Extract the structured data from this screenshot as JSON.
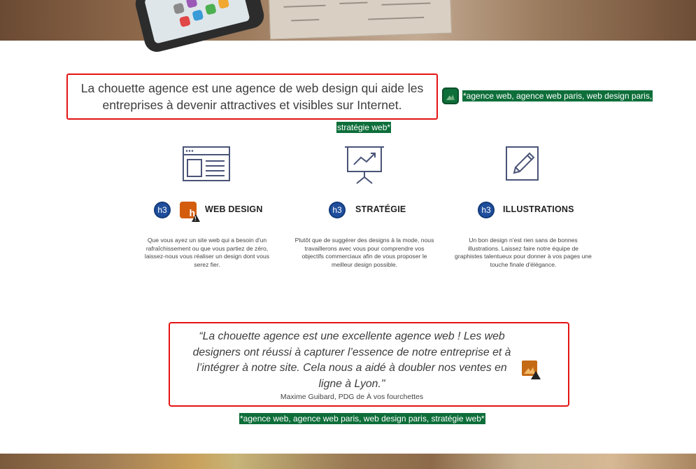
{
  "intro": {
    "text": "La chouette agence est une agence de web design qui aide les entreprises à devenir attractives et visibles sur Internet.",
    "alt_line1": "*agence web, agence web paris, web design paris,",
    "alt_line2": "stratégie web*"
  },
  "services": [
    {
      "icon": "browser-window-icon",
      "heading_tag": "h3",
      "title": "WEB DESIGN",
      "text": "Que vous ayez un site web qui a besoin d'un rafraîchissement ou que vous partiez de zéro, laissez-nous vous réaliser un design dont vous serez fier."
    },
    {
      "icon": "presentation-chart-icon",
      "heading_tag": "h3",
      "title": "STRATÉGIE",
      "text": "Plutôt que de suggérer des designs à la mode, nous travaillerons avec vous pour comprendre vos objectifs commerciaux afin de vous proposer le meilleur design possible."
    },
    {
      "icon": "pencil-edit-icon",
      "heading_tag": "h3",
      "title": "ILLUSTRATIONS",
      "text": "Un bon design n'est rien sans de bonnes illustrations. Laissez faire notre équipe de graphistes talentueux pour donner à vos pages une touche finale d'élégance."
    }
  ],
  "warning_badge": "h",
  "testimonial": {
    "quote": "“La chouette agence est une excellente agence web ! Les web designers ont réussi à capturer l’essence de notre entreprise et à l’intégrer à notre site. Cela nous a aidé à doubler nos ventes en ligne à Lyon.\"",
    "author": "Maxime Guibard, PDG de À vos fourchettes",
    "alt_text": "*agence web, agence web paris, web design paris, stratégie web*"
  },
  "colors": {
    "highlight_border": "#e31414",
    "alt_tag_bg": "#0e6e3a",
    "heading_badge": "#1f4e9c",
    "warning_badge": "#d35d0c",
    "icon_stroke": "#4a5478"
  }
}
